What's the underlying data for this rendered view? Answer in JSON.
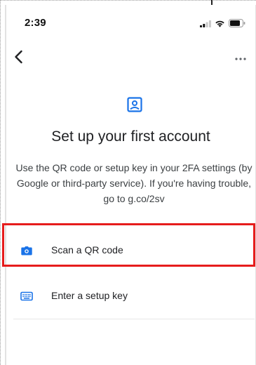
{
  "status_bar": {
    "time": "2:39",
    "icons": [
      "signal-icon",
      "wifi-icon",
      "battery-icon"
    ]
  },
  "nav": {
    "back_icon": "chevron-left-icon",
    "more_icon": "more-horizontal-icon"
  },
  "hero": {
    "icon": "account-box-icon",
    "title": "Set up your first account",
    "subtitle": "Use the QR code or setup key in your 2FA settings (by Google or third-party service). If you're having trouble, go to g.co/2sv"
  },
  "options": [
    {
      "icon": "camera-icon",
      "label": "Scan a QR code"
    },
    {
      "icon": "keyboard-icon",
      "label": "Enter a setup key"
    }
  ],
  "colors": {
    "accent": "#1a73e8",
    "highlight": "#e61c1c"
  }
}
